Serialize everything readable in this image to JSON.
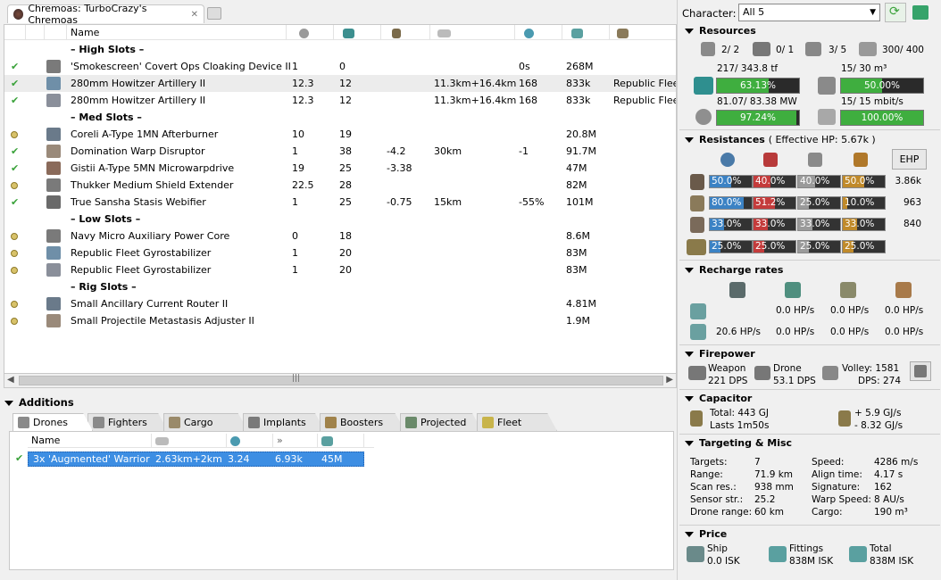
{
  "tab": {
    "title": "Chremoas: TurboCrazy's Chremoas"
  },
  "columns": {
    "name": "Name"
  },
  "modules": [
    {
      "type": "section",
      "name": "– High Slots –"
    },
    {
      "type": "mod",
      "state": "check",
      "name": "'Smokescreen' Covert Ops Cloaking Device II",
      "c1": "1",
      "c2": "0",
      "c3": "",
      "c4": "",
      "c5": "0s",
      "c6": "268M",
      "c7": ""
    },
    {
      "type": "mod",
      "state": "check",
      "sel": true,
      "name": "280mm Howitzer Artillery II",
      "c1": "12.3",
      "c2": "12",
      "c3": "",
      "c4": "11.3km+16.4km",
      "c5": "168",
      "c6": "833k",
      "c7": "Republic Fleet"
    },
    {
      "type": "mod",
      "state": "check",
      "name": "280mm Howitzer Artillery II",
      "c1": "12.3",
      "c2": "12",
      "c3": "",
      "c4": "11.3km+16.4km",
      "c5": "168",
      "c6": "833k",
      "c7": "Republic Fleet"
    },
    {
      "type": "section",
      "name": "– Med Slots –"
    },
    {
      "type": "mod",
      "state": "online",
      "name": "Coreli A-Type 1MN Afterburner",
      "c1": "10",
      "c2": "19",
      "c3": "",
      "c4": "",
      "c5": "",
      "c6": "20.8M",
      "c7": ""
    },
    {
      "type": "mod",
      "state": "check",
      "name": "Domination Warp Disruptor",
      "c1": "1",
      "c2": "38",
      "c3": "-4.2",
      "c4": "30km",
      "c5": "-1",
      "c6": "91.7M",
      "c7": ""
    },
    {
      "type": "mod",
      "state": "check",
      "name": "Gistii A-Type 5MN Microwarpdrive",
      "c1": "19",
      "c2": "25",
      "c3": "-3.38",
      "c4": "",
      "c5": "",
      "c6": "47M",
      "c7": ""
    },
    {
      "type": "mod",
      "state": "online",
      "name": "Thukker Medium Shield Extender",
      "c1": "22.5",
      "c2": "28",
      "c3": "",
      "c4": "",
      "c5": "",
      "c6": "82M",
      "c7": ""
    },
    {
      "type": "mod",
      "state": "check",
      "name": "True Sansha Stasis Webifier",
      "c1": "1",
      "c2": "25",
      "c3": "-0.75",
      "c4": "15km",
      "c5": "-55%",
      "c6": "101M",
      "c7": ""
    },
    {
      "type": "section",
      "name": "– Low Slots –"
    },
    {
      "type": "mod",
      "state": "online",
      "name": "Navy Micro Auxiliary Power Core",
      "c1": "0",
      "c2": "18",
      "c3": "",
      "c4": "",
      "c5": "",
      "c6": "8.6M",
      "c7": ""
    },
    {
      "type": "mod",
      "state": "online",
      "name": "Republic Fleet Gyrostabilizer",
      "c1": "1",
      "c2": "20",
      "c3": "",
      "c4": "",
      "c5": "",
      "c6": "83M",
      "c7": ""
    },
    {
      "type": "mod",
      "state": "online",
      "name": "Republic Fleet Gyrostabilizer",
      "c1": "1",
      "c2": "20",
      "c3": "",
      "c4": "",
      "c5": "",
      "c6": "83M",
      "c7": ""
    },
    {
      "type": "section",
      "name": "– Rig Slots –"
    },
    {
      "type": "mod",
      "state": "online",
      "name": "Small Ancillary Current Router II",
      "c1": "",
      "c2": "",
      "c3": "",
      "c4": "",
      "c5": "",
      "c6": "4.81M",
      "c7": ""
    },
    {
      "type": "mod",
      "state": "online",
      "name": "Small Projectile Metastasis Adjuster II",
      "c1": "",
      "c2": "",
      "c3": "",
      "c4": "",
      "c5": "",
      "c6": "1.9M",
      "c7": ""
    }
  ],
  "additions": {
    "title": "Additions",
    "tabs": [
      "Drones",
      "Fighters",
      "Cargo",
      "Implants",
      "Boosters",
      "Projected",
      "Fleet"
    ],
    "columns": {
      "name": "Name"
    },
    "drone": {
      "name": "3x 'Augmented' Warrior",
      "range": "2.63km+2km",
      "c2": "3.24",
      "c3": "6.93k",
      "price": "45M"
    }
  },
  "character": {
    "label": "Character:",
    "value": "All 5"
  },
  "resources": {
    "title": "Resources",
    "turrets": "2/ 2",
    "launchers": "0/ 1",
    "drones_active": "3/ 5",
    "drone_bay": "300/ 400",
    "cpu_text": "217/ 343.8 tf",
    "cpu_pct": "63.13%",
    "cpu_frac": 0.6313,
    "bay_text": "15/ 30 m³",
    "bay_pct": "50.00%",
    "bay_frac": 0.5,
    "pg_text": "81.07/ 83.38 MW",
    "pg_pct": "97.24%",
    "pg_frac": 0.9724,
    "bw_text": "15/ 15 mbit/s",
    "bw_pct": "100.00%",
    "bw_frac": 1.0
  },
  "resistances": {
    "title": "Resistances",
    "ehp_label": "( Effective HP: 5.67k )",
    "ehp_button": "EHP",
    "rows": [
      {
        "vals": [
          "50.0%",
          "40.0%",
          "40.0%",
          "50.0%"
        ],
        "fracs": [
          0.5,
          0.4,
          0.4,
          0.5
        ],
        "hp": "3.86k"
      },
      {
        "vals": [
          "80.0%",
          "51.2%",
          "25.0%",
          "10.0%"
        ],
        "fracs": [
          0.8,
          0.512,
          0.25,
          0.1
        ],
        "hp": "963"
      },
      {
        "vals": [
          "33.0%",
          "33.0%",
          "33.0%",
          "33.0%"
        ],
        "fracs": [
          0.33,
          0.33,
          0.33,
          0.33
        ],
        "hp": "840"
      },
      {
        "vals": [
          "25.0%",
          "25.0%",
          "25.0%",
          "25.0%"
        ],
        "fracs": [
          0.25,
          0.25,
          0.25,
          0.25
        ],
        "hp": ""
      }
    ]
  },
  "recharge": {
    "title": "Recharge rates",
    "row1": [
      "0.0 HP/s",
      "0.0 HP/s",
      "0.0 HP/s"
    ],
    "row2": [
      "20.6 HP/s",
      "0.0 HP/s",
      "0.0 HP/s",
      "0.0 HP/s"
    ]
  },
  "firepower": {
    "title": "Firepower",
    "weapon_label": "Weapon",
    "weapon_dps": "221 DPS",
    "drone_label": "Drone",
    "drone_dps": "53.1 DPS",
    "volley": "Volley: 1581",
    "dps": "DPS: 274"
  },
  "capacitor": {
    "title": "Capacitor",
    "total": "Total: 443 GJ",
    "lasts": "Lasts 1m50s",
    "plus": "+  5.9  GJ/s",
    "minus": "-  8.32 GJ/s"
  },
  "targeting": {
    "title": "Targeting & Misc",
    "left": [
      [
        "Targets:",
        "7"
      ],
      [
        "Range:",
        "71.9 km"
      ],
      [
        "Scan res.:",
        "938 mm"
      ],
      [
        "Sensor str.:",
        "25.2"
      ],
      [
        "Drone range:",
        "60 km"
      ]
    ],
    "right": [
      [
        "Speed:",
        "4286 m/s"
      ],
      [
        "Align time:",
        "4.17 s"
      ],
      [
        "Signature:",
        "162"
      ],
      [
        "Warp Speed:",
        "8 AU/s"
      ],
      [
        "Cargo:",
        "190 m³"
      ]
    ]
  },
  "price": {
    "title": "Price",
    "ship_label": "Ship",
    "ship": "0.0 ISK",
    "fit_label": "Fittings",
    "fit": "838M ISK",
    "total_label": "Total",
    "total": "838M ISK"
  }
}
